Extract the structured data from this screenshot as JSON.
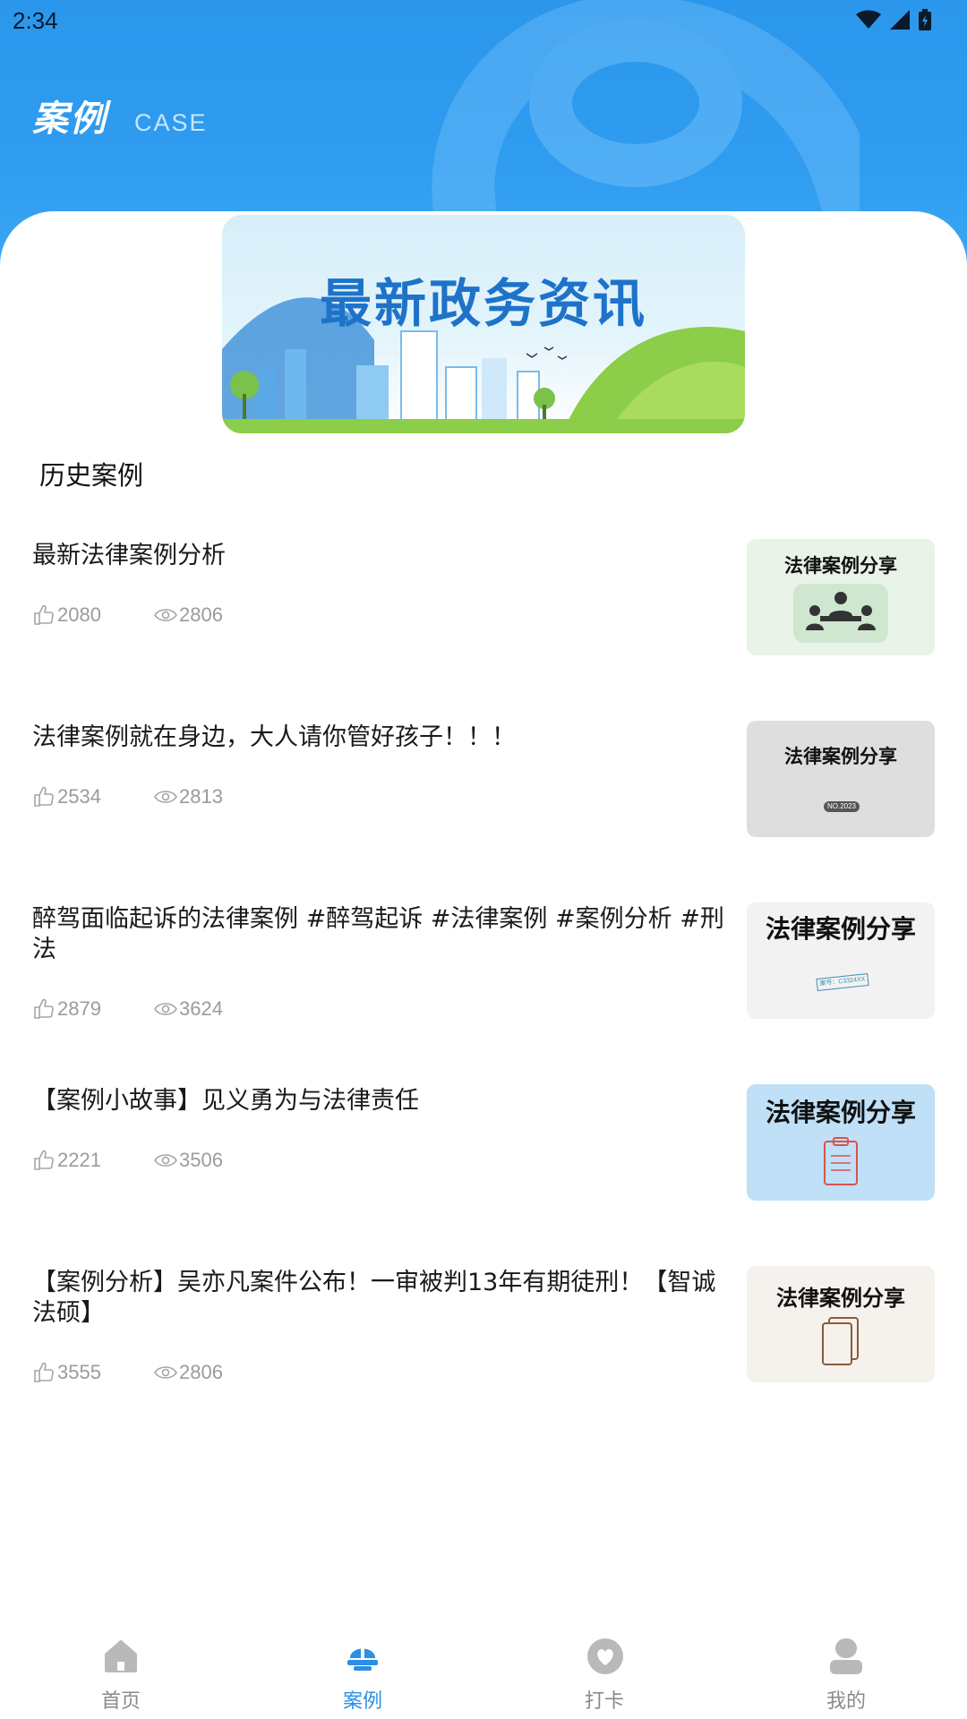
{
  "status_bar": {
    "time": "2:34"
  },
  "header": {
    "title": "案例",
    "subtitle": "CASE"
  },
  "banner": {
    "title": "最新政务资讯"
  },
  "section": {
    "title": "历史案例"
  },
  "cases": [
    {
      "title": "最新法律案例分析",
      "likes": "2080",
      "views": "2806",
      "thumb_title": "法律案例分享",
      "thumb_bg": "#e9f3e7"
    },
    {
      "title": "法律案例就在身边，大人请你管好孩子！！！",
      "likes": "2534",
      "views": "2813",
      "thumb_title": "法律案例分享",
      "thumb_badge": "NO.2023",
      "thumb_bg": "#dedede"
    },
    {
      "title": "醉驾面临起诉的法律案例 #醉驾起诉 #法律案例 #案例分析 #刑法",
      "likes": "2879",
      "views": "3624",
      "thumb_title": "法律案例分享",
      "thumb_stamp": "案号：C3324XX",
      "thumb_bg": "#f2f2f2"
    },
    {
      "title": "【案例小故事】见义勇为与法律责任",
      "likes": "2221",
      "views": "3506",
      "thumb_title": "法律案例分享",
      "thumb_bg": "#bfe0f6"
    },
    {
      "title": "【案例分析】吴亦凡案件公布！一审被判13年有期徒刑！【智诚法硕】",
      "likes": "3555",
      "views": "2806",
      "thumb_title": "法律案例分享",
      "thumb_bg": "#f5f1ec"
    }
  ],
  "nav": {
    "items": [
      {
        "label": "首页",
        "icon": "home-icon"
      },
      {
        "label": "案例",
        "icon": "scale-icon"
      },
      {
        "label": "打卡",
        "icon": "heart-icon"
      },
      {
        "label": "我的",
        "icon": "user-icon"
      }
    ],
    "active_index": 1
  },
  "colors": {
    "brand": "#2b97ec",
    "nav_active": "#2b8fe6",
    "nav_inactive": "#8a8a8a",
    "meta": "#9b9b9b"
  }
}
